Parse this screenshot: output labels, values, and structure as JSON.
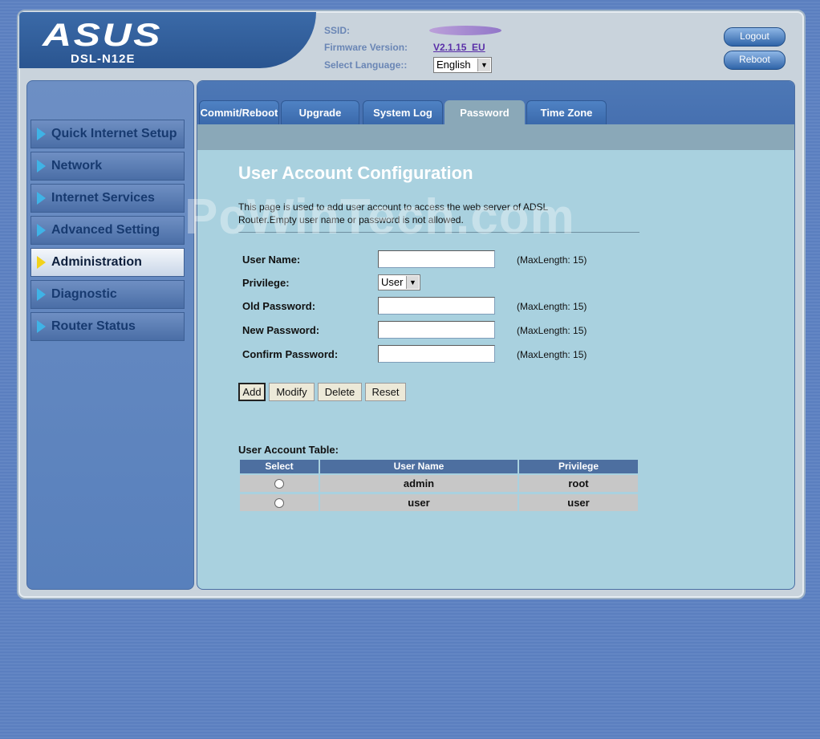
{
  "header": {
    "brand": "ASUS",
    "model": "DSL-N12E",
    "ssid_label": "SSID:",
    "firmware_label": "Firmware Version:",
    "firmware_value": "V2.1.15_EU",
    "language_label": "Select Language::",
    "language_value": "English",
    "logout_label": "Logout",
    "reboot_label": "Reboot"
  },
  "sidebar": {
    "items": [
      {
        "label": "Quick Internet Setup"
      },
      {
        "label": "Network"
      },
      {
        "label": "Internet Services"
      },
      {
        "label": "Advanced Setting"
      },
      {
        "label": "Administration"
      },
      {
        "label": "Diagnostic"
      },
      {
        "label": "Router Status"
      }
    ],
    "active": "Administration"
  },
  "tabs": [
    "Commit/Reboot",
    "Upgrade",
    "System Log",
    "Password",
    "Time Zone"
  ],
  "active_tab": "Password",
  "main": {
    "title": "User Account Configuration",
    "description": "This page is used to add user account to access the web server of ADSL Router.Empty user name or password is not allowed.",
    "watermark": "PcWinTech.com"
  },
  "form": {
    "username_label": "User Name:",
    "privilege_label": "Privilege:",
    "privilege_value": "User",
    "old_password_label": "Old Password:",
    "new_password_label": "New Password:",
    "confirm_password_label": "Confirm Password:",
    "maxlength_hint": "(MaxLength: 15)"
  },
  "buttons": {
    "add": "Add",
    "modify": "Modify",
    "delete": "Delete",
    "reset": "Reset"
  },
  "table": {
    "title": "User Account Table:",
    "headers": [
      "Select",
      "User Name",
      "Privilege"
    ],
    "rows": [
      {
        "username": "admin",
        "privilege": "root"
      },
      {
        "username": "user",
        "privilege": "user"
      }
    ]
  },
  "colors": {
    "accent": "#4d78b6",
    "panel": "#a9d1df",
    "active_arrow": "#f2d21b",
    "menu_arrow": "#3fb3e6"
  }
}
